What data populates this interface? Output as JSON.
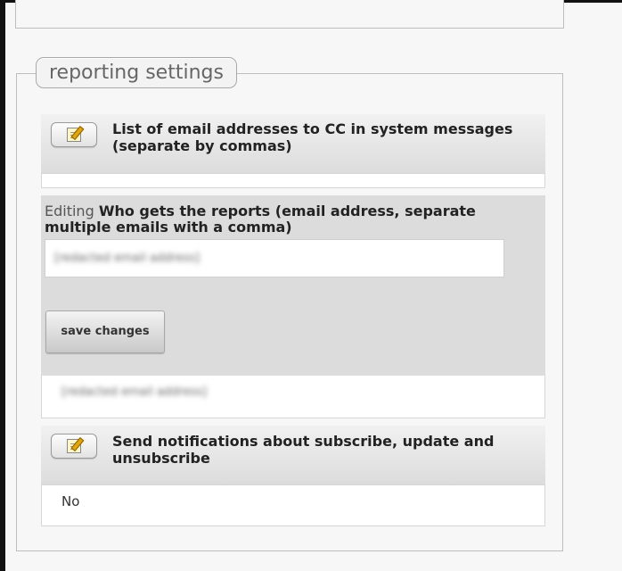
{
  "fieldset": {
    "legend": "reporting settings"
  },
  "rows": [
    {
      "title": "List of email addresses to CC in system messages (separate by commas)",
      "value": "",
      "edit_icon": "edit-note-icon"
    },
    {
      "editing_prefix": "Editing",
      "title": "Who gets the reports (email address, separate multiple emails with a comma)",
      "input_value": "[redacted email address]",
      "save_label": "save changes",
      "current_value": "[redacted email address]"
    },
    {
      "title": "Send notifications about subscribe, update and unsubscribe",
      "value": "No",
      "edit_icon": "edit-note-icon"
    }
  ]
}
